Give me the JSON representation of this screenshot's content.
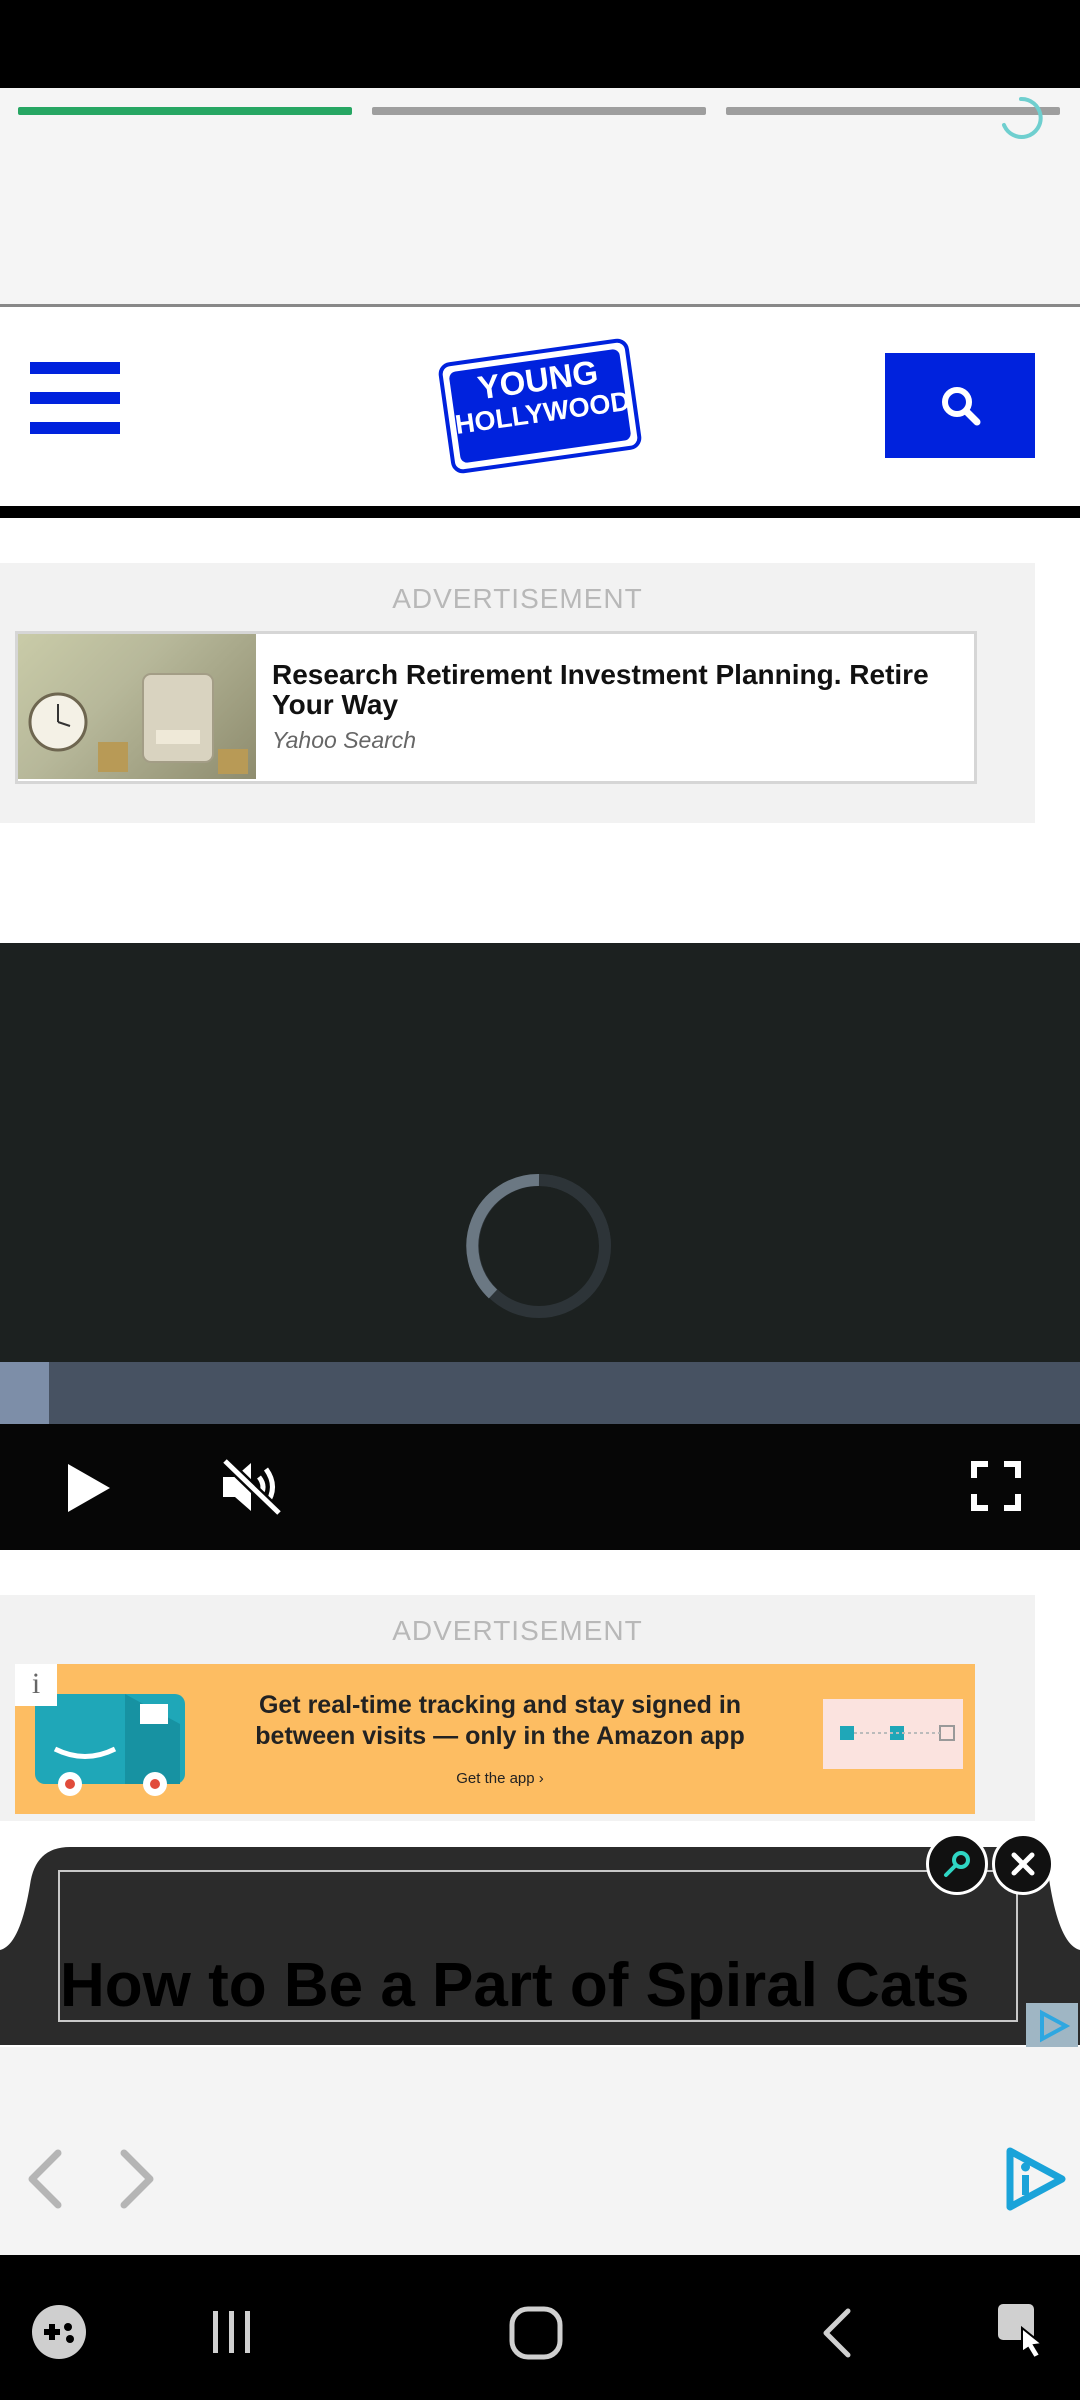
{
  "header": {
    "logo_line1": "YOUNG",
    "logo_line2": "HOLLYWOOD"
  },
  "story": {
    "segments_total": 3,
    "segments_complete": 1
  },
  "ads": [
    {
      "label": "ADVERTISEMENT",
      "title": "Research Retirement Investment Planning. Retire Your Way",
      "source": "Yahoo Search"
    },
    {
      "label": "ADVERTISEMENT",
      "info_glyph": "i",
      "line1": "Get real-time tracking and stay signed in",
      "line2": "between visits — only in the Amazon app",
      "cta": "Get the app ›"
    }
  ],
  "video": {
    "progress_fraction": 0.045,
    "muted": true
  },
  "overlay": {
    "title": "How to Be a Part of Spiral Cats"
  },
  "colors": {
    "brand_blue": "#0022dd",
    "story_progress_active": "#27a663",
    "ad_banner_bg": "#fdbd62",
    "brand_teal": "#1aa3d9"
  },
  "icons": {
    "menu": "hamburger-icon",
    "search": "search-icon",
    "play": "play-icon",
    "mute": "volume-muted-icon",
    "fullscreen": "fullscreen-icon",
    "close": "close-icon",
    "pin": "pin-icon"
  }
}
